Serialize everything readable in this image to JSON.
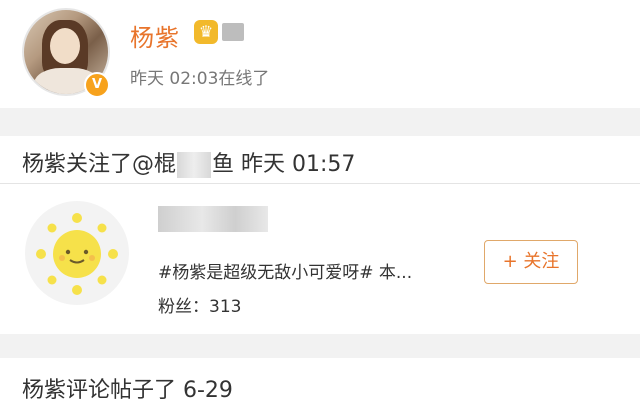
{
  "profile": {
    "name": "杨紫",
    "online_status": "昨天 02:03在线了",
    "crown_icon": "crown-icon",
    "verified_icon": "verified-v-icon"
  },
  "activity_follow": {
    "prefix": "杨紫关注了@棍",
    "suffix": "鱼 昨天 01:57"
  },
  "card": {
    "description": "#杨紫是超级无敌小可爱呀# 本...",
    "fans": "粉丝：313",
    "follow_button": "+ 关注"
  },
  "activity_comment": {
    "text": "杨紫评论帖子了 6-29"
  },
  "colors": {
    "accent": "#e8742b",
    "sun": "#f6e14a",
    "divider": "#f2f2f2"
  }
}
